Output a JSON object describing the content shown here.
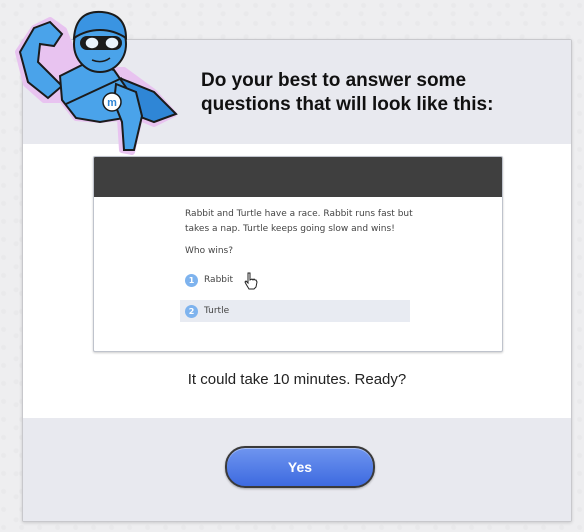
{
  "header": {
    "title": "Do your best to answer some questions that will look like this:"
  },
  "preview": {
    "passage": "Rabbit and Turtle have a race. Rabbit runs fast but takes a nap. Turtle keeps going slow and wins!",
    "question": "Who wins?",
    "options": [
      {
        "num": "1",
        "label": "Rabbit"
      },
      {
        "num": "2",
        "label": "Turtle"
      }
    ]
  },
  "ready_text": "It could take 10 minutes. Ready?",
  "buttons": {
    "yes_label": "Yes"
  },
  "mascot": {
    "icon": "superhero-mascot-icon",
    "badge_letter": "m"
  },
  "colors": {
    "accent": "#4a78e6",
    "option_badge": "#7eb3ee",
    "mascot_blue": "#4aa3ea"
  }
}
